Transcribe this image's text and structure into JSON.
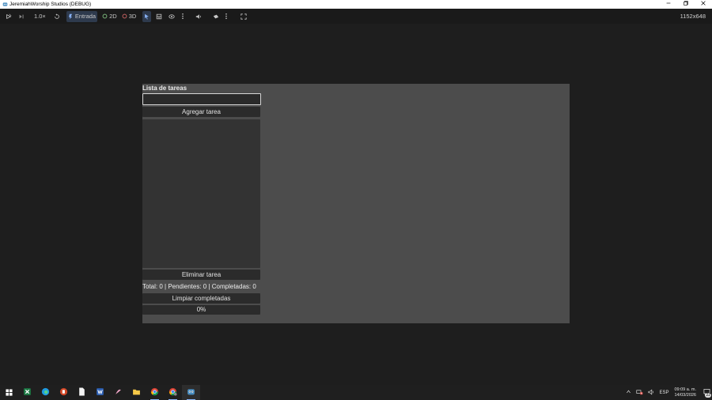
{
  "window": {
    "title": "JeremiahWorship Studios (DEBUG)",
    "controls": [
      "minimize",
      "maximize",
      "close"
    ]
  },
  "toolbar": {
    "speed": "1.0×",
    "input_label": "Entrada",
    "mode_2d": "2D",
    "mode_3d": "3D",
    "resolution": "1152x648",
    "icons": [
      "pause-icon",
      "step-icon",
      "reset-icon",
      "select-icon",
      "list-icon",
      "eye-icon",
      "more-icon",
      "audio-icon",
      "camera-icon",
      "more-icon",
      "fullscreen-icon"
    ]
  },
  "app": {
    "title": "Lista de tareas",
    "input_value": "",
    "add_button": "Agregar tarea",
    "delete_button": "Eliminar tarea",
    "stats": "Total:  0 | Pendientes: 0 | Completadas: 0",
    "clear_button": "Limpiar completadas",
    "progress_label": "0%",
    "progress_fraction": 0,
    "tasks": []
  },
  "taskbar": {
    "apps": [
      "windows-start",
      "excel",
      "edge",
      "powerpoint",
      "file",
      "word",
      "paint",
      "file-explorer",
      "chrome",
      "chrome-profile",
      "godot"
    ],
    "language": "ESP",
    "time": "09:09 a. m.",
    "date": "14/03/2026",
    "notifications": "22"
  },
  "colors": {
    "accent": "#478cbf",
    "game_background": "#4c4c4c",
    "panel": "#2b2b2b"
  }
}
